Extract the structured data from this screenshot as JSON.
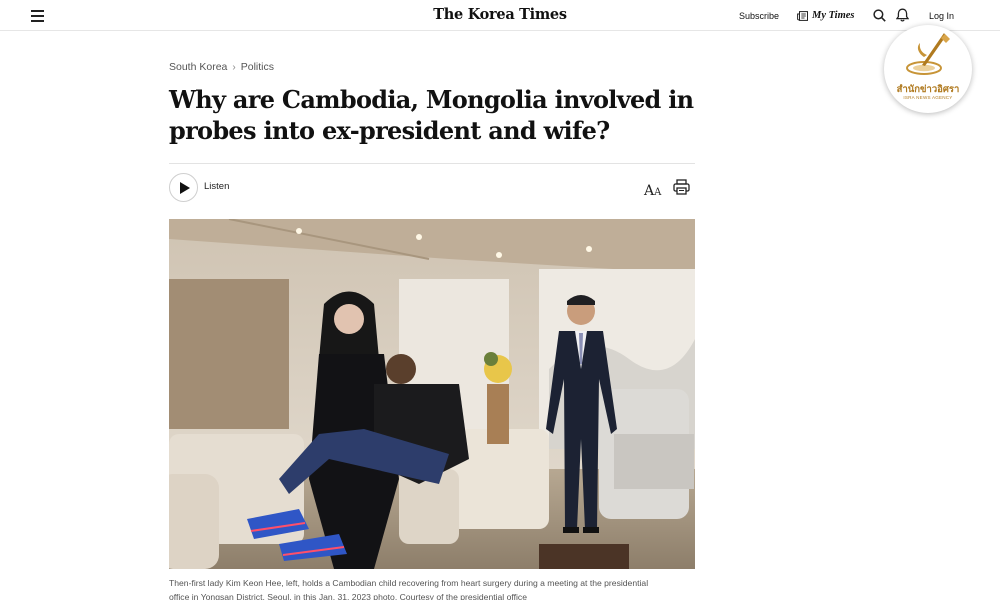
{
  "header": {
    "logo": "The Korea Times",
    "subscribe": "Subscribe",
    "my_times": "My Times",
    "login": "Log In"
  },
  "badge": {
    "thai_text": "สำนักข่าวอิศรา",
    "english_text": "ISRA NEWS AGENCY"
  },
  "breadcrumb": {
    "section": "South Korea",
    "subsection": "Politics"
  },
  "article": {
    "title_line1": "Why are Cambodia, Mongolia involved in",
    "title_line2": "probes into ex-president and wife?",
    "listen": "Listen",
    "font_size_icon": "font-size-icon",
    "print_icon": "printer-icon"
  },
  "photo": {
    "caption_line1": "Then-first lady Kim Keon Hee, left, holds a Cambodian child recovering from heart surgery during a meeting at the presidential",
    "caption_line2": "office in Yongsan District, Seoul, in this Jan. 31, 2023 photo. Courtesy of the presidential office"
  },
  "colors": {
    "badge_gold": "#b07a1f",
    "divider": "#e3e3e3"
  }
}
